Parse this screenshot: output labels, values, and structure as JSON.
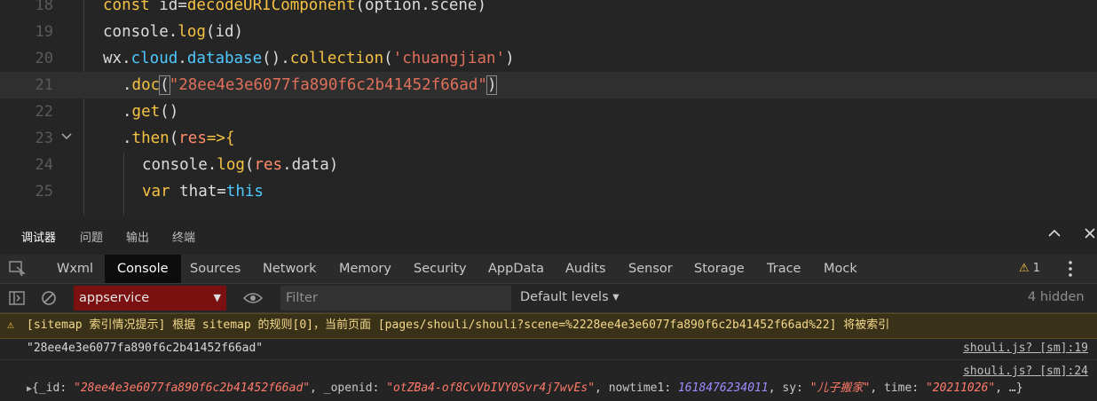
{
  "editor": {
    "lines": [
      {
        "n": "18"
      },
      {
        "n": "19"
      },
      {
        "n": "20"
      },
      {
        "n": "21"
      },
      {
        "n": "22"
      },
      {
        "n": "23"
      },
      {
        "n": "24"
      },
      {
        "n": "25"
      }
    ],
    "code": {
      "l18": {
        "kw": "const",
        "a": " id=",
        "fn": "decodeURIComponent",
        "b": "(option.scene)"
      },
      "l19": {
        "a": "console.",
        "fn": "log",
        "b": "(id)"
      },
      "l20": {
        "a": "wx.",
        "p1": "cloud",
        "d1": ".",
        "p2": "database",
        "b1": "().",
        "fn": "collection",
        "b2": "(",
        "str": "'chuangjian'",
        "b3": ")"
      },
      "l21": {
        "d": ".",
        "fn": "doc",
        "b1": "(",
        "str": "\"28ee4e3e6077fa890f6c2b41452f66ad\"",
        "b2": ")"
      },
      "l22": {
        "d": ".",
        "fn": "get",
        "b": "()"
      },
      "l23": {
        "d": ".",
        "fn": "then",
        "b1": "(",
        "v": "res",
        "op": "=>",
        "b2": "{"
      },
      "l24": {
        "a": "console.",
        "fn": "log",
        "b1": "(",
        "v": "res",
        "b2": ".data)"
      },
      "l25": {
        "kw": "var",
        "a": " that=",
        "p": "this"
      }
    },
    "fold_icon": "chevron-down-icon"
  },
  "panel": {
    "top_tabs": [
      "调试器",
      "问题",
      "输出",
      "终端"
    ],
    "dev_tabs": [
      "Wxml",
      "Console",
      "Sources",
      "Network",
      "Memory",
      "Security",
      "AppData",
      "Audits",
      "Sensor",
      "Storage",
      "Trace",
      "Mock"
    ],
    "active_dev_tab": "Console",
    "warning_count": "1",
    "context": "appservice",
    "filter_placeholder": "Filter",
    "levels": "Default levels ▾",
    "hidden": "4 hidden"
  },
  "console": {
    "warning": "[sitemap 索引情况提示] 根据 sitemap 的规则[0]，当前页面 [pages/shouli/shouli?scene=%2228ee4e3e6077fa890f6c2b41452f66ad%22] 将被索引",
    "log1": {
      "text": "\"28ee4e3e6077fa890f6c2b41452f66ad\"",
      "src": "shouli.js? [sm]:19"
    },
    "log2": {
      "src": "shouli.js? [sm]:24",
      "k1": "_id",
      "v1": "\"28ee4e3e6077fa890f6c2b41452f66ad\"",
      "k2": "_openid",
      "v2": "\"otZBa4-of8CvVbIVY0Svr4j7wvEs\"",
      "k3": "nowtime1",
      "v3": "1618476234011",
      "k4": "sy",
      "v4": "\"儿子搬家\"",
      "k5": "time",
      "v5": "\"20211026\"",
      "tail": ", …}"
    }
  },
  "colors": {
    "accent_error": "#7a1010",
    "warning_bg": "#3a3218"
  }
}
